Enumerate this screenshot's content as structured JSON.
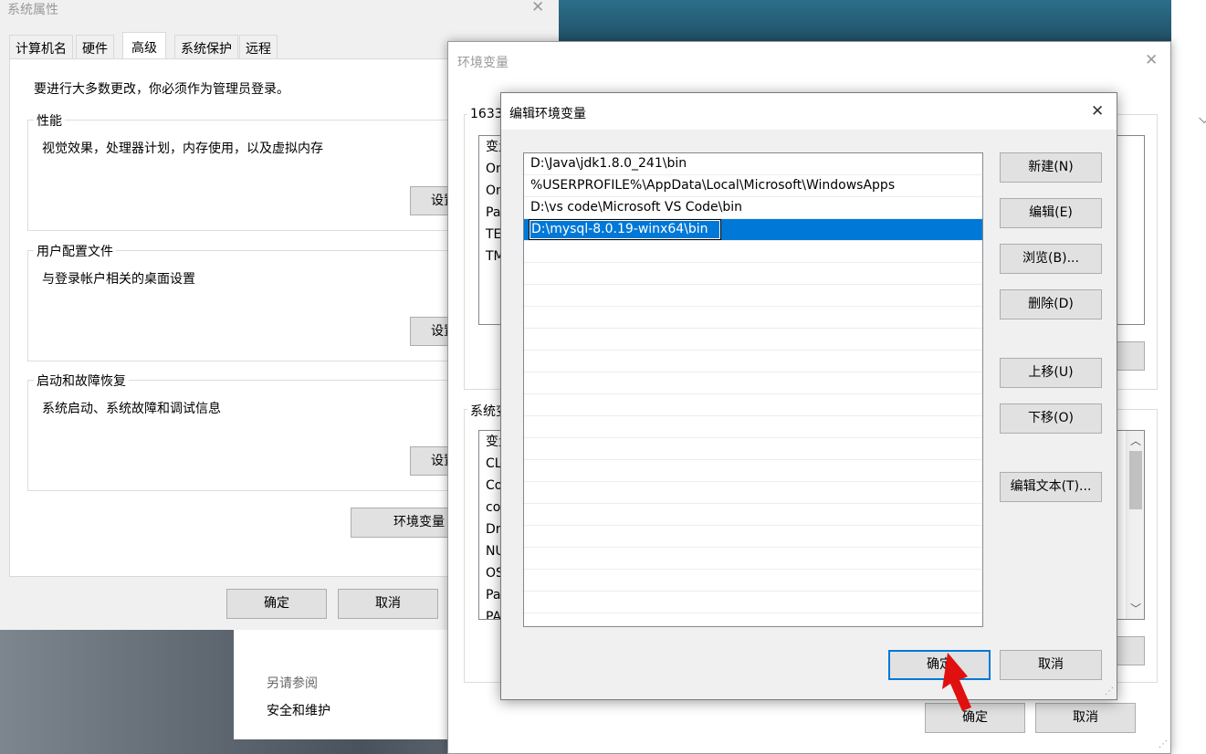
{
  "system_properties": {
    "title": "系统属性",
    "tabs": [
      "计算机名",
      "硬件",
      "高级",
      "系统保护",
      "远程"
    ],
    "admin_notice": "要进行大多数更改，你必须作为管理员登录。",
    "performance": {
      "title": "性能",
      "desc": "视觉效果，处理器计划，内存使用，以及虚拟内存",
      "button": "设置"
    },
    "user_profiles": {
      "title": "用户配置文件",
      "desc": "与登录帐户相关的桌面设置",
      "button": "设置"
    },
    "startup_recovery": {
      "title": "启动和故障恢复",
      "desc": "系统启动、系统故障和调试信息",
      "button": "设置"
    },
    "env_button": "环境变量",
    "ok": "确定",
    "cancel": "取消"
  },
  "settings_fragment": {
    "see_also": "另请参阅",
    "security_link": "安全和维护"
  },
  "env_vars": {
    "title": "环境变量",
    "user_group_title": "1633",
    "user_vars": [
      "变量",
      "On",
      "On",
      "Pa",
      "TE",
      "TM"
    ],
    "system_group_title": "系统变",
    "system_vars": [
      "变量",
      "CL",
      "Co",
      "co",
      "Dr",
      "NU",
      "OS",
      "Pa",
      "PA"
    ],
    "ok": "确定",
    "cancel": "取消"
  },
  "edit_env_var": {
    "title": "编辑环境变量",
    "entries": [
      "D:\\Java\\jdk1.8.0_241\\bin",
      "%USERPROFILE%\\AppData\\Local\\Microsoft\\WindowsApps",
      "D:\\vs code\\Microsoft VS Code\\bin",
      "D:\\mysql-8.0.19-winx64\\bin"
    ],
    "buttons": {
      "new": "新建(N)",
      "edit": "编辑(E)",
      "browse": "浏览(B)...",
      "delete": "删除(D)",
      "move_up": "上移(U)",
      "move_down": "下移(O)",
      "edit_text": "编辑文本(T)..."
    },
    "ok": "确定",
    "cancel": "取消"
  },
  "annotation": {
    "arrow_color": "#e01010"
  },
  "colors": {
    "selection": "#0078d7",
    "button_face": "#e1e1e1"
  }
}
